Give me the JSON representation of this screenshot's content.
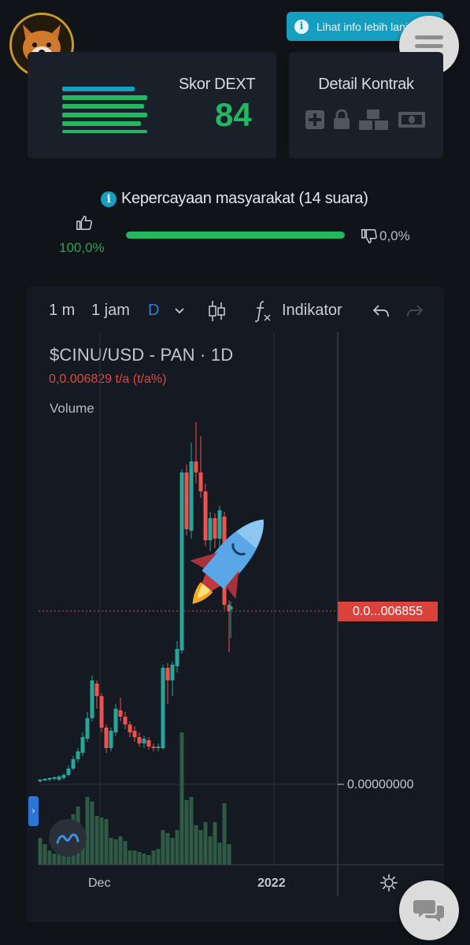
{
  "header": {
    "info_button": "Lihat info lebih lanjut"
  },
  "score": {
    "title": "Skor DEXT",
    "value": "84"
  },
  "contract": {
    "title": "Detail Kontrak",
    "icons": [
      "plus-square-icon",
      "lock-icon",
      "cubes-icon",
      "money-icon"
    ]
  },
  "trust": {
    "title": "Kepercayaan masyarakat (14 suara)",
    "up_pct": "100,0%",
    "down_pct": "0,0%",
    "up_fraction": 1.0
  },
  "chart": {
    "toolbar": {
      "interval_1m": "1 m",
      "interval_1h": "1 jam",
      "interval_d": "D",
      "indicators": "Indikator"
    },
    "title": "$CINU/USD - PAN · 1D",
    "price_line": "0,0.006829  t/a (t/a%)",
    "volume_label": "Volume",
    "price_tag": "0.0...006855",
    "zero_label": "0.00000000",
    "x_labels": [
      "Dec",
      "2022"
    ]
  },
  "chart_data": {
    "type": "candlestick",
    "title": "$CINU/USD - PAN · 1D",
    "last_price": "0.0...006855",
    "x_axis_labels": [
      "Dec",
      "2022"
    ],
    "y_axis_labels": [
      "0.0...006855",
      "0.00000000"
    ],
    "series": [
      {
        "name": "Volume",
        "type": "bar"
      }
    ],
    "colors": {
      "up": "#26a69a",
      "down": "#ef5350",
      "price_line": "#d9433b"
    }
  },
  "colors": {
    "accent": "#169ec0",
    "green": "#22b760",
    "red": "#d9433b"
  }
}
